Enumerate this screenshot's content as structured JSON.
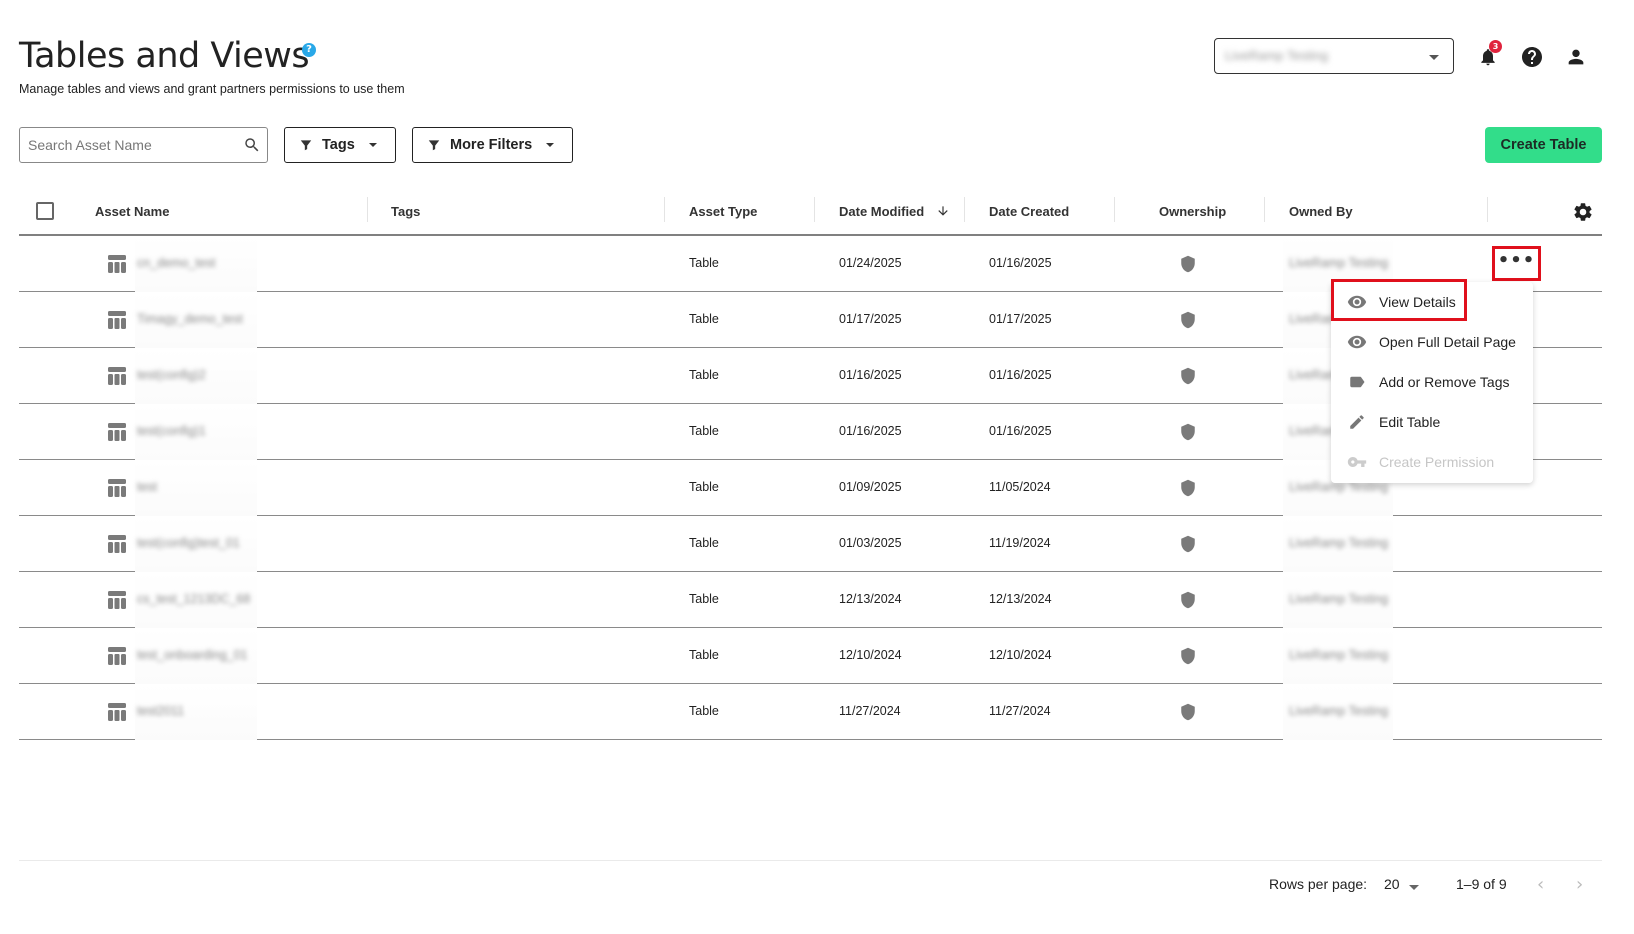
{
  "header": {
    "title": "Tables and Views",
    "help_badge": "?",
    "subtitle": "Manage tables and views and grant partners permissions to use them",
    "org_selector": "LiveRamp Testing",
    "notification_count": "3"
  },
  "toolbar": {
    "search_placeholder": "Search Asset Name",
    "search_value": "",
    "tags_label": "Tags",
    "more_filters_label": "More Filters",
    "create_label": "Create Table",
    "accent": "#32dd8a"
  },
  "table": {
    "columns": [
      "Asset Name",
      "Tags",
      "Asset Type",
      "Date Modified",
      "Date Created",
      "Ownership",
      "Owned By"
    ],
    "sort": {
      "column": "Date Modified",
      "direction": "descending"
    },
    "rows": [
      {
        "name": "cn_demo_test",
        "tags": "",
        "type": "Table",
        "modified": "01/24/2025",
        "created": "01/16/2025",
        "owned_by": "LiveRamp Testing"
      },
      {
        "name": "Timagy_demo_test",
        "tags": "",
        "type": "Table",
        "modified": "01/17/2025",
        "created": "01/17/2025",
        "owned_by": "LiveRamp Testing"
      },
      {
        "name": "test(config)2",
        "tags": "",
        "type": "Table",
        "modified": "01/16/2025",
        "created": "01/16/2025",
        "owned_by": "LiveRamp Testing"
      },
      {
        "name": "test(config)1",
        "tags": "",
        "type": "Table",
        "modified": "01/16/2025",
        "created": "01/16/2025",
        "owned_by": "LiveRamp Testing"
      },
      {
        "name": "test",
        "tags": "",
        "type": "Table",
        "modified": "01/09/2025",
        "created": "11/05/2024",
        "owned_by": "LiveRamp Testing"
      },
      {
        "name": "test(config)test_01",
        "tags": "",
        "type": "Table",
        "modified": "01/03/2025",
        "created": "11/19/2024",
        "owned_by": "LiveRamp Testing"
      },
      {
        "name": "cs_test_1213DC_68",
        "tags": "",
        "type": "Table",
        "modified": "12/13/2024",
        "created": "12/13/2024",
        "owned_by": "LiveRamp Testing"
      },
      {
        "name": "test_onboarding_01",
        "tags": "",
        "type": "Table",
        "modified": "12/10/2024",
        "created": "12/10/2024",
        "owned_by": "LiveRamp Testing"
      },
      {
        "name": "test2011",
        "tags": "",
        "type": "Table",
        "modified": "11/27/2024",
        "created": "11/27/2024",
        "owned_by": "LiveRamp Testing"
      }
    ]
  },
  "row_menu": {
    "items": [
      {
        "label": "View Details",
        "icon": "eye-icon",
        "disabled": false,
        "highlighted": true
      },
      {
        "label": "Open Full Detail Page",
        "icon": "eye-icon",
        "disabled": false
      },
      {
        "label": "Add or Remove Tags",
        "icon": "tag-icon",
        "disabled": false
      },
      {
        "label": "Edit Table",
        "icon": "pencil-icon",
        "disabled": false
      },
      {
        "label": "Create Permission",
        "icon": "key-icon",
        "disabled": true
      }
    ]
  },
  "pagination": {
    "rows_per_page_label": "Rows per page:",
    "rows_per_page": "20",
    "range": "1–9 of 9"
  }
}
